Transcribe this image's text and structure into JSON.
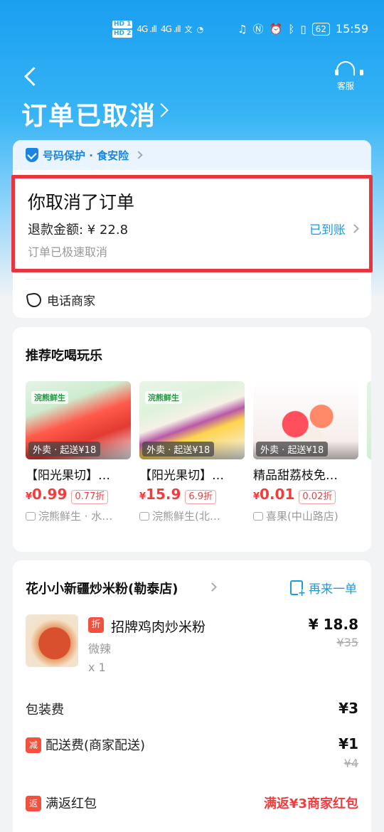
{
  "status_bar": {
    "hd1": "HD 1",
    "hd2": "HD 2",
    "signal1": "4G .ıll",
    "signal2": "4G .ıll",
    "battery": "62",
    "time": "15:59"
  },
  "header": {
    "title": "订单已取消",
    "service_label": "客服"
  },
  "protection": {
    "label": "号码保护 · 食安险"
  },
  "cancel": {
    "title": "你取消了订单",
    "refund_line": "退款金额: ¥ 22.8",
    "refund_status": "已到账",
    "note": "订单已极速取消"
  },
  "call": {
    "label": "电话商家"
  },
  "recommend": {
    "title": "推荐吃喝玩乐",
    "items": [
      {
        "brand": "浣熊鲜生",
        "tag": "外卖 · 起送¥18",
        "name": "【阳光果切】…",
        "price_symbol": "¥",
        "price": "0.99",
        "discount": "0.77折",
        "shop": "浣熊鲜生 · 水…"
      },
      {
        "brand": "浣熊鲜生",
        "tag": "外卖 · 起送¥18",
        "name": "【阳光果切】…",
        "price_symbol": "¥",
        "price": "15.9",
        "discount": "6.9折",
        "shop": "浣熊鲜生(北…"
      },
      {
        "tag": "外卖 · 起送¥18",
        "name": "精品甜荔枝免…",
        "price_symbol": "¥",
        "price": "0.01",
        "discount": "0.02折",
        "shop": "喜果(中山路店)"
      }
    ]
  },
  "order": {
    "shop_name": "花小小新疆炒米粉(勒泰店)",
    "reorder_label": "再来一单",
    "dish": {
      "badge": "折",
      "name": "招牌鸡肉炒米粉",
      "spec": "微辣",
      "qty": "x 1",
      "price": "¥ 18.8",
      "original_price": "¥35"
    },
    "packing": {
      "label": "包装费",
      "value": "¥3"
    },
    "delivery": {
      "badge": "减",
      "label": "配送费(商家配送)",
      "value": "¥1",
      "original": "¥4"
    },
    "cashback": {
      "badge": "返",
      "label": "满返红包",
      "value": "满返¥3商家红包"
    }
  }
}
